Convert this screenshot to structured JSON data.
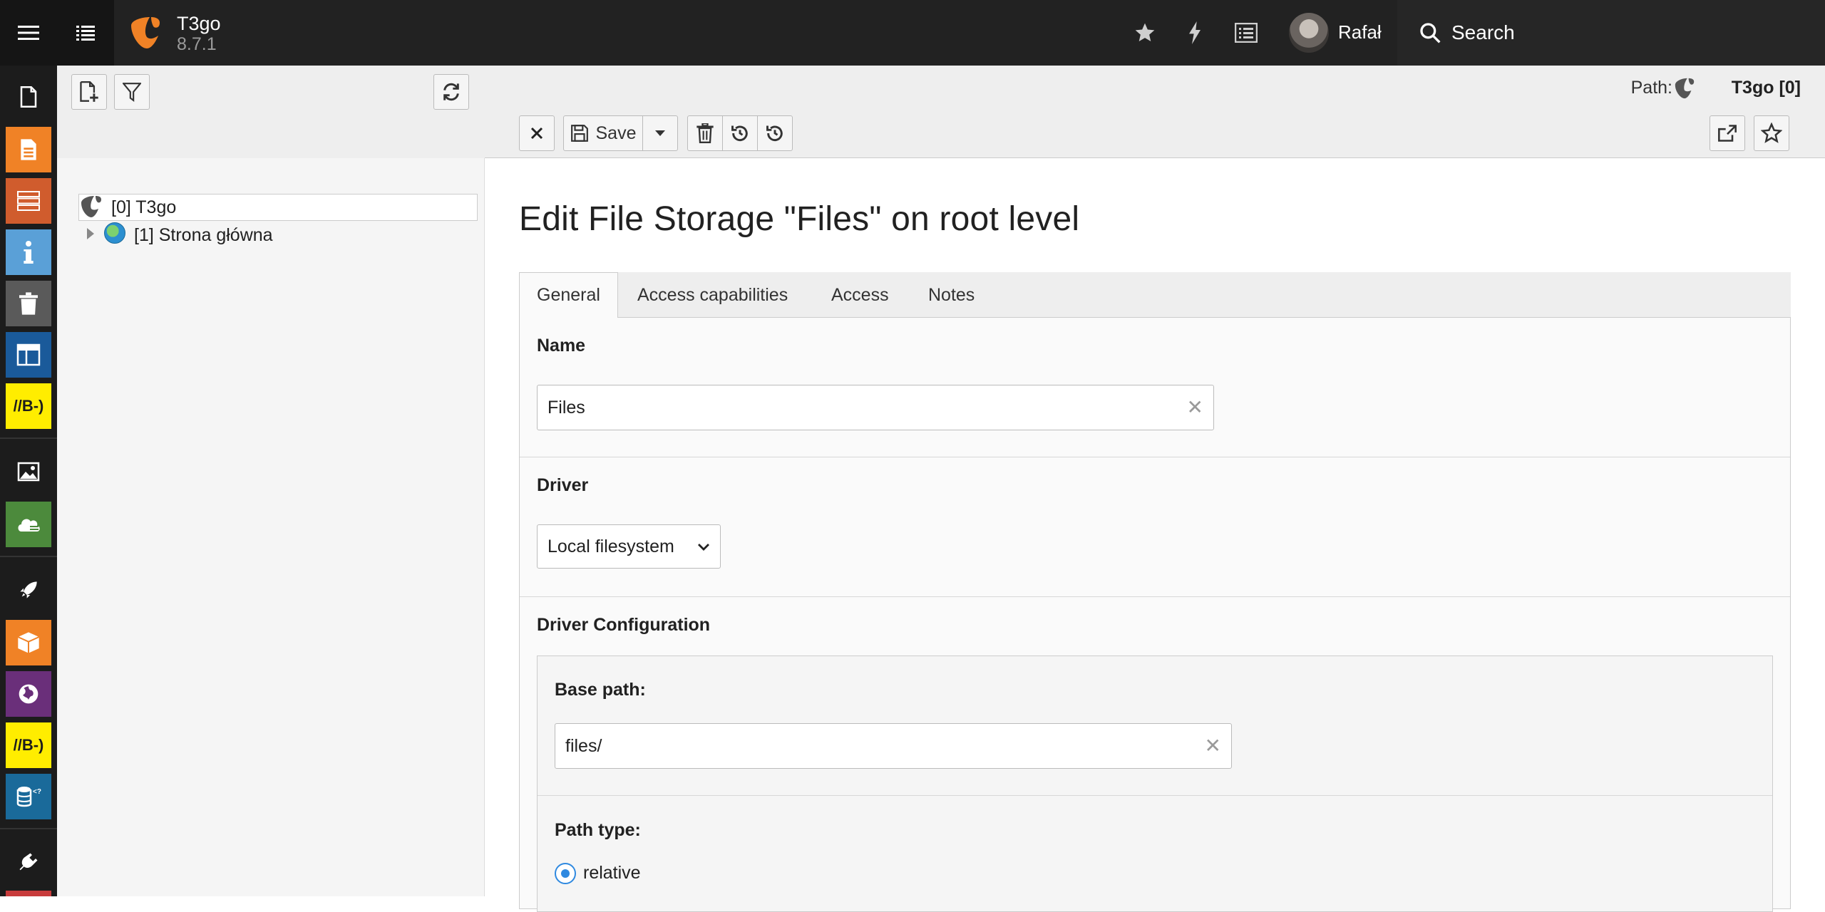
{
  "topbar": {
    "site_name": "T3go",
    "site_version": "8.7.1",
    "user_name": "Rafał",
    "search_label": "Search"
  },
  "tree": {
    "root_label": "[0] T3go",
    "child_label": "[1] Strona główna"
  },
  "doc_header": {
    "path_label": "Path:",
    "path_value": "T3go [0]",
    "save_label": "Save"
  },
  "page_title": "Edit File Storage \"Files\" on root level",
  "tabs": [
    {
      "label": "General"
    },
    {
      "label": "Access capabilities"
    },
    {
      "label": "Access"
    },
    {
      "label": "Notes"
    }
  ],
  "form": {
    "name_label": "Name",
    "name_value": "Files",
    "driver_label": "Driver",
    "driver_value": "Local filesystem",
    "driver_config_label": "Driver Configuration",
    "base_path_label": "Base path:",
    "base_path_value": "files/",
    "path_type_label": "Path type:",
    "path_type_option": "relative"
  },
  "modules": [
    {
      "icon": "page-icon",
      "color": "#1c1c1c"
    },
    {
      "icon": "view-icon",
      "color": "#f08226"
    },
    {
      "icon": "list-icon",
      "color": "#d05c2d"
    },
    {
      "icon": "info-icon",
      "color": "#5aa0d7"
    },
    {
      "icon": "recycler-icon",
      "color": "#5a5a5a"
    },
    {
      "icon": "layout-icon",
      "color": "#1a5a9a"
    },
    {
      "icon": "extension-b-icon",
      "color": "#ffed00"
    },
    {
      "icon": "filelist-icon",
      "color": "#1c1c1c"
    },
    {
      "icon": "cloud-icon",
      "color": "#4c8a3c"
    },
    {
      "icon": "rocket-icon",
      "color": "#1c1c1c"
    },
    {
      "icon": "package-icon",
      "color": "#f08226"
    },
    {
      "icon": "globe-icon",
      "color": "#6a2f7a"
    },
    {
      "icon": "extension-b-icon",
      "color": "#ffed00"
    },
    {
      "icon": "database-icon",
      "color": "#1a6a9a"
    },
    {
      "icon": "plug-icon",
      "color": "#1c1c1c"
    }
  ],
  "colors": {
    "accent": "#2f89e0",
    "typo3_orange": "#f08226"
  }
}
